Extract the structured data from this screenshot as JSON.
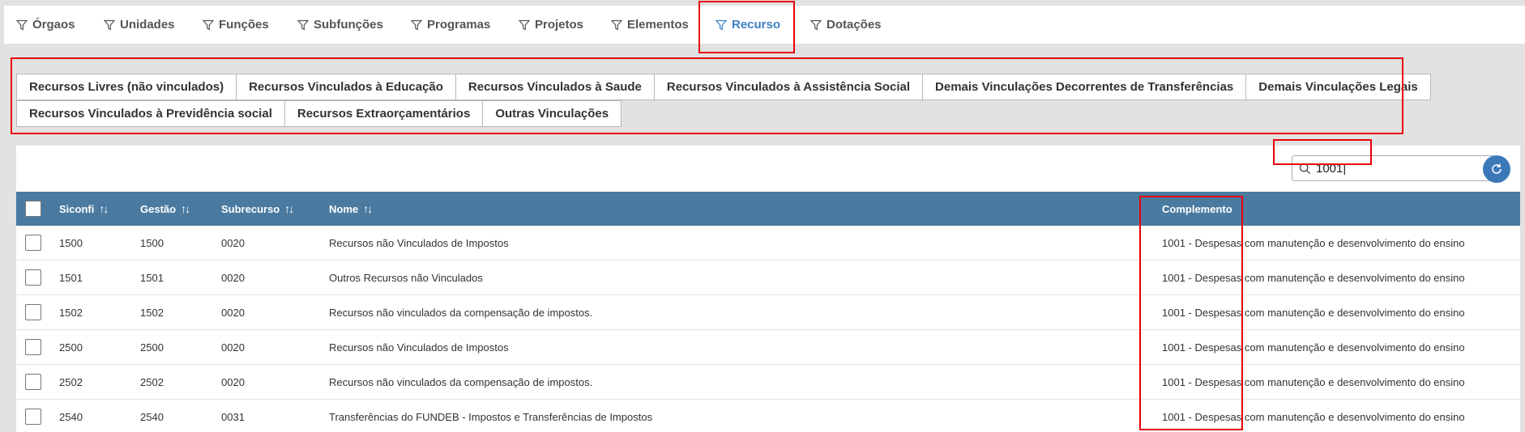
{
  "tabs": [
    {
      "label": "Órgaos",
      "icon": "filter-icon"
    },
    {
      "label": "Unidades",
      "icon": "filter-icon"
    },
    {
      "label": "Funções",
      "icon": "filter-icon"
    },
    {
      "label": "Subfunções",
      "icon": "filter-icon"
    },
    {
      "label": "Programas",
      "icon": "filter-icon"
    },
    {
      "label": "Projetos",
      "icon": "filter-icon"
    },
    {
      "label": "Elementos",
      "icon": "filter-icon"
    },
    {
      "label": "Recurso",
      "icon": "filter-icon",
      "active": true
    },
    {
      "label": "Dotações",
      "icon": "filter-icon"
    }
  ],
  "categories_row1": [
    "Recursos Livres (não vinculados)",
    "Recursos Vinculados à Educação",
    "Recursos Vinculados à Saude",
    "Recursos Vinculados à Assistência Social",
    "Demais Vinculações Decorrentes de Transferências",
    "Demais Vinculações Legais"
  ],
  "categories_row2": [
    "Recursos Vinculados à Previdência social",
    "Recursos Extraorçamentários",
    "Outras Vinculações"
  ],
  "search": {
    "value": "1001|"
  },
  "table": {
    "headers": {
      "siconfi": "Siconfi",
      "gestao": "Gestão",
      "subrecurso": "Subrecurso",
      "nome": "Nome",
      "complemento": "Complemento"
    },
    "sort_glyph": "↑↓",
    "rows": [
      {
        "siconfi": "1500",
        "gestao": "1500",
        "subrecurso": "0020",
        "nome": "Recursos não Vinculados de Impostos",
        "complemento": "1001 - Despesas com manutenção e desenvolvimento do ensino"
      },
      {
        "siconfi": "1501",
        "gestao": "1501",
        "subrecurso": "0020",
        "nome": "Outros Recursos não Vinculados",
        "complemento": "1001 - Despesas com manutenção e desenvolvimento do ensino"
      },
      {
        "siconfi": "1502",
        "gestao": "1502",
        "subrecurso": "0020",
        "nome": "Recursos não vinculados da compensação de impostos.",
        "complemento": "1001 - Despesas com manutenção e desenvolvimento do ensino"
      },
      {
        "siconfi": "2500",
        "gestao": "2500",
        "subrecurso": "0020",
        "nome": "Recursos não Vinculados de Impostos",
        "complemento": "1001 - Despesas com manutenção e desenvolvimento do ensino"
      },
      {
        "siconfi": "2502",
        "gestao": "2502",
        "subrecurso": "0020",
        "nome": "Recursos não vinculados da compensação de impostos.",
        "complemento": "1001 - Despesas com manutenção e desenvolvimento do ensino"
      },
      {
        "siconfi": "2540",
        "gestao": "2540",
        "subrecurso": "0031",
        "nome": "Transferências do FUNDEB - Impostos e Transferências de Impostos",
        "complemento": "1001 - Despesas com manutenção e desenvolvimento do ensino"
      }
    ]
  },
  "colors": {
    "accent": "#3d7fc4",
    "header_bg": "#4a7aa0",
    "highlight": "#e8000b"
  }
}
